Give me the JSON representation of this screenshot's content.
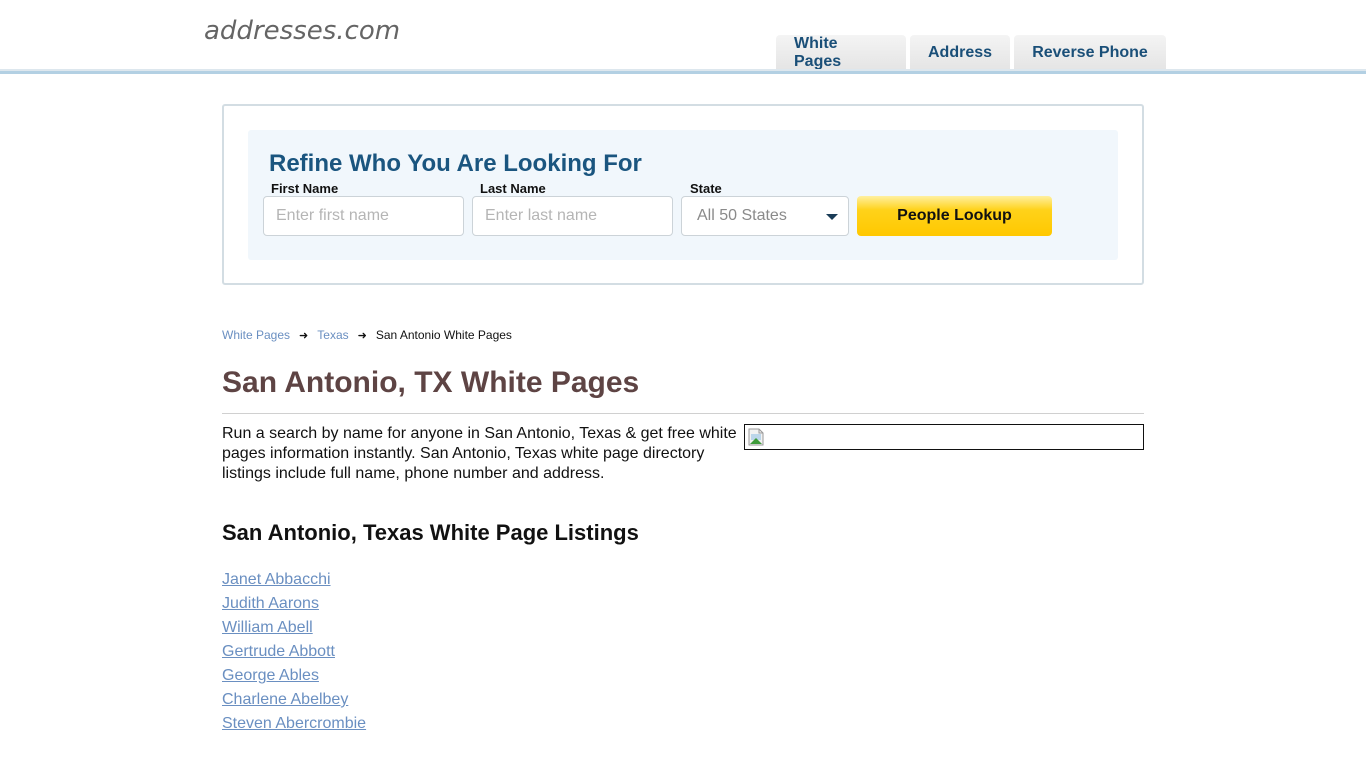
{
  "header": {
    "logo": "addresses.com",
    "tabs": [
      {
        "label": "White Pages"
      },
      {
        "label": "Address"
      },
      {
        "label": "Reverse Phone"
      }
    ]
  },
  "search": {
    "title": "Refine Who You Are Looking For",
    "first_name": {
      "label": "First Name",
      "placeholder": "Enter first name",
      "value": ""
    },
    "last_name": {
      "label": "Last Name",
      "placeholder": "Enter last name",
      "value": ""
    },
    "state": {
      "label": "State",
      "selected": "All 50 States"
    },
    "button_label": "People Lookup"
  },
  "breadcrumb": {
    "items": [
      {
        "label": "White Pages"
      },
      {
        "label": "Texas"
      }
    ],
    "current": "San Antonio White Pages",
    "separator_icon": "arrow-right-icon"
  },
  "main": {
    "title": "San Antonio, TX White Pages",
    "intro": "Run a search by name for anyone in San Antonio, Texas & get free white pages information instantly. San Antonio, Texas white page directory listings include full name, phone number and address.",
    "listings_title": "San Antonio, Texas White Page Listings",
    "listings": [
      {
        "name": "Janet Abbacchi"
      },
      {
        "name": "Judith Aarons"
      },
      {
        "name": "William Abell"
      },
      {
        "name": "Gertrude Abbott"
      },
      {
        "name": "George Ables"
      },
      {
        "name": "Charlene Abelbey"
      },
      {
        "name": "Steven Abercrombie"
      }
    ]
  },
  "colors": {
    "brand_blue": "#1a557f",
    "link_blue": "#6a8fc1",
    "title_brown": "#5e4444",
    "button_yellow": "#ffc800"
  }
}
